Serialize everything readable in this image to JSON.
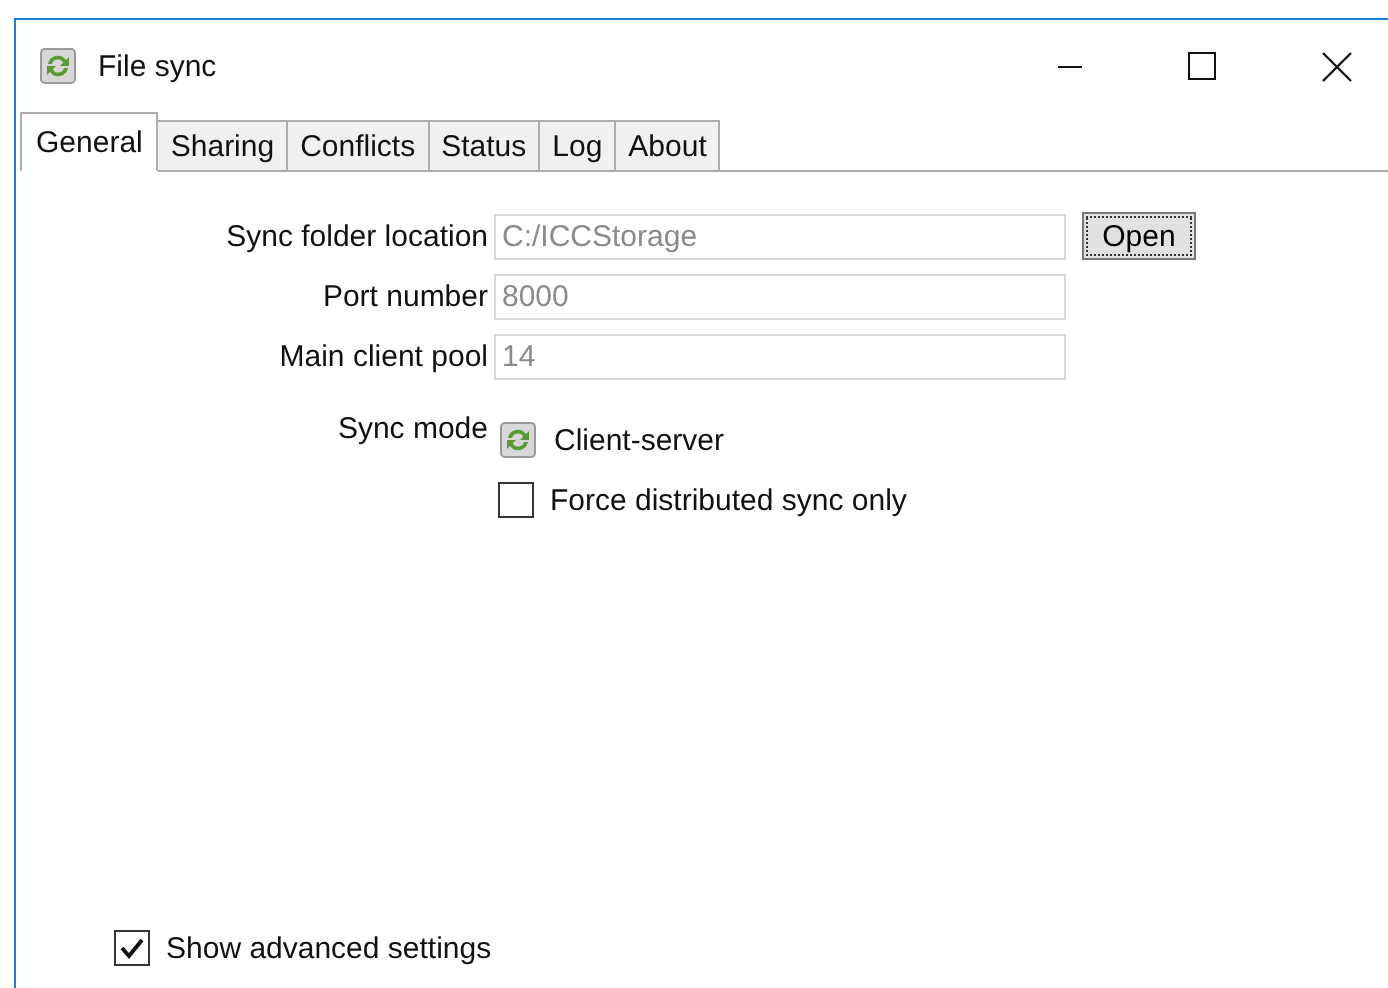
{
  "window": {
    "title": "File sync"
  },
  "tabs": [
    {
      "label": "General",
      "selected": true
    },
    {
      "label": "Sharing",
      "selected": false
    },
    {
      "label": "Conflicts",
      "selected": false
    },
    {
      "label": "Status",
      "selected": false
    },
    {
      "label": "Log",
      "selected": false
    },
    {
      "label": "About",
      "selected": false
    }
  ],
  "fields": [
    {
      "label": "Sync folder location",
      "value": "C:/ICCStorage",
      "disabled": true,
      "button": "Open"
    },
    {
      "label": "Port number",
      "value": "8000",
      "disabled": true
    },
    {
      "label": "Main client pool",
      "value": "14",
      "disabled": true
    }
  ],
  "sync_mode": {
    "label": "Sync mode",
    "value": "Client-server"
  },
  "force_distributed": {
    "label": "Force distributed sync only",
    "checked": false
  },
  "show_advanced": {
    "label": "Show advanced settings",
    "checked": true
  }
}
